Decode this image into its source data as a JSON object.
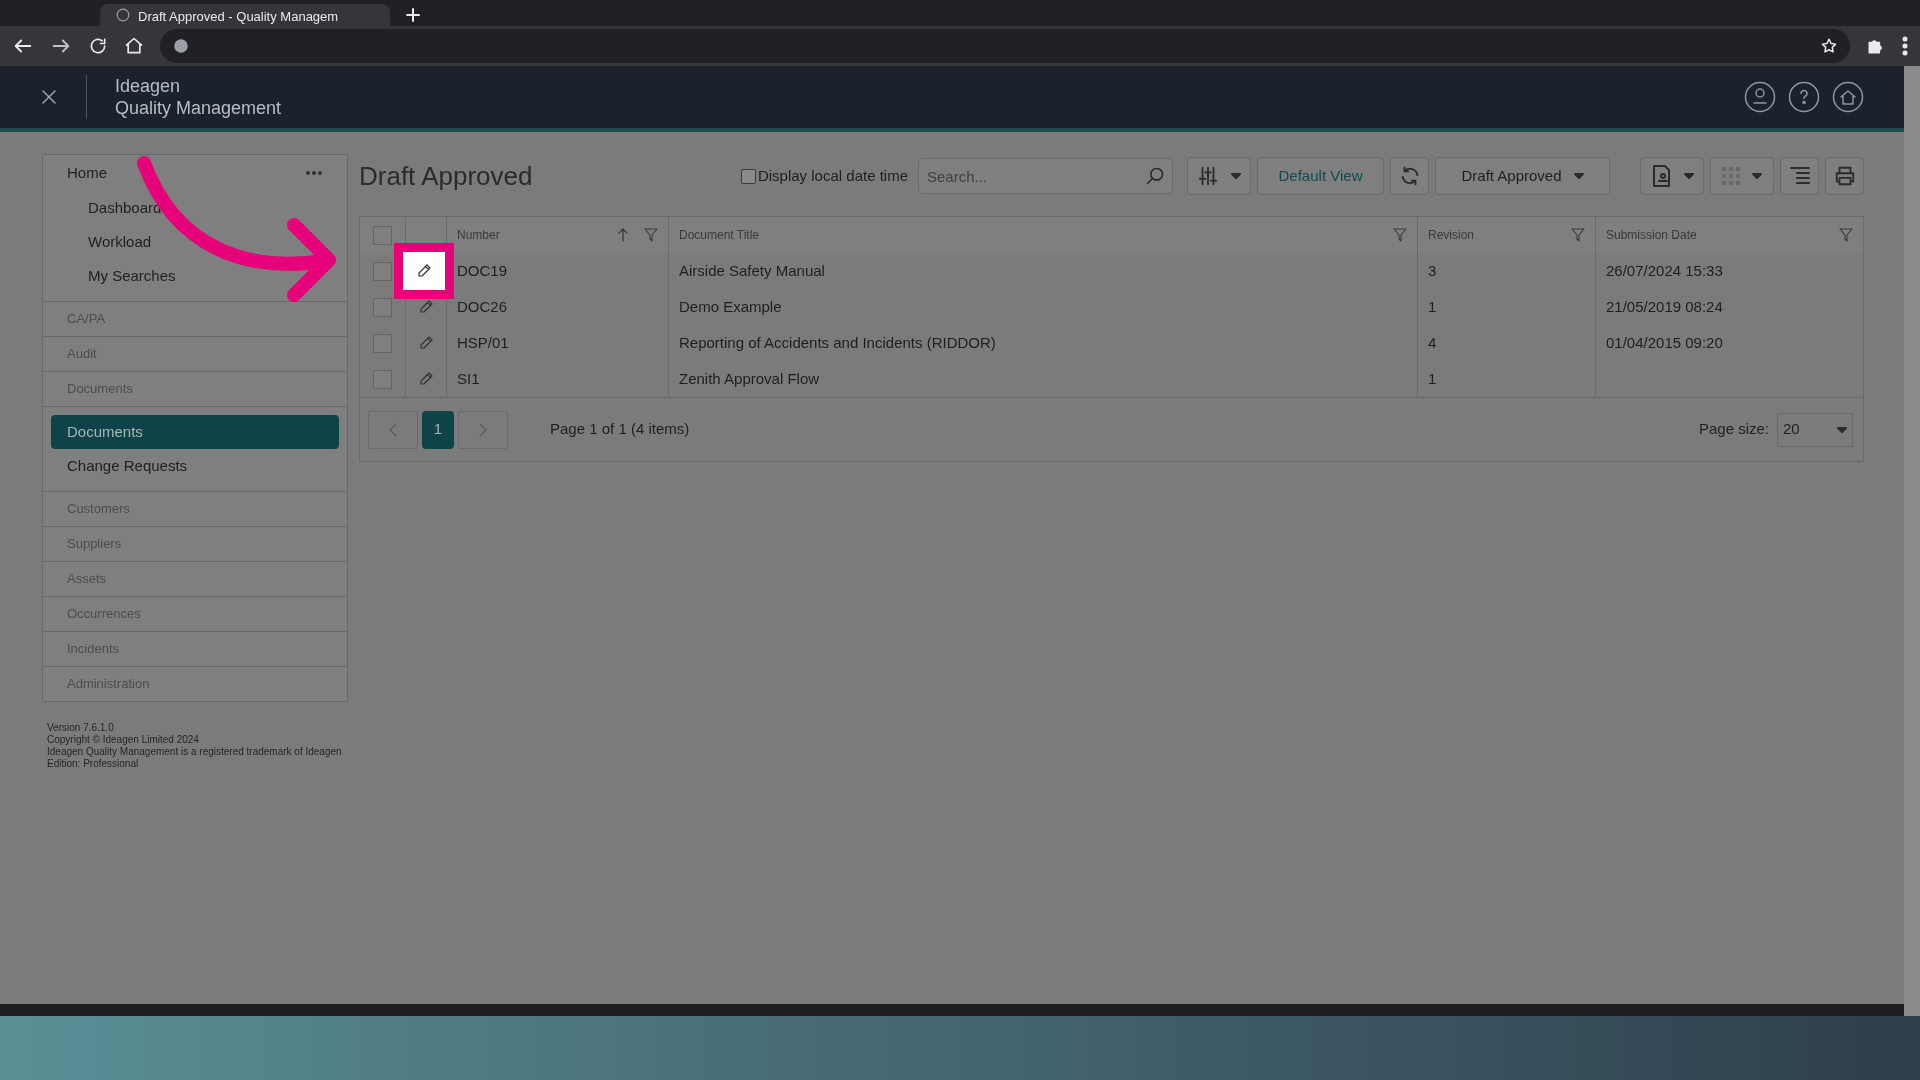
{
  "browser": {
    "tab_title": "Draft Approved - Quality Managem"
  },
  "app_header": {
    "brand": "Ideagen",
    "product": "Quality Management"
  },
  "sidebar": {
    "home": {
      "label": "Home",
      "children": [
        {
          "label": "Dashboard",
          "selected": false
        },
        {
          "label": "Workload",
          "selected": false
        },
        {
          "label": "My Searches",
          "selected": false
        }
      ]
    },
    "sections": [
      {
        "label": "CA/PA"
      },
      {
        "label": "Audit"
      },
      {
        "label": "Documents",
        "children": [
          {
            "label": "Documents",
            "selected": true
          },
          {
            "label": "Change Requests",
            "selected": false
          }
        ]
      },
      {
        "label": "Customers"
      },
      {
        "label": "Suppliers"
      },
      {
        "label": "Assets"
      },
      {
        "label": "Occurrences"
      },
      {
        "label": "Incidents"
      },
      {
        "label": "Administration"
      }
    ],
    "footer": [
      "Version 7.6.1.0",
      "Copyright © Ideagen Limited 2024",
      "Ideagen Quality Management is a registered trademark of Ideagen",
      "Edition: Professional"
    ]
  },
  "page_title": "Draft Approved",
  "toolbar": {
    "local_date_time": {
      "label": "Display local date time",
      "checked": false
    },
    "search": {
      "placeholder": "Search..."
    },
    "default_view": "Default View",
    "view_select": "Draft Approved"
  },
  "table": {
    "all_selected": false,
    "columns": [
      {
        "label": "Number",
        "sort_ascending": true,
        "filter": true
      },
      {
        "label": "Document Title",
        "sort_ascending": false,
        "filter": true
      },
      {
        "label": "Revision",
        "sort_ascending": false,
        "filter": true
      },
      {
        "label": "Submission Date",
        "sort_ascending": false,
        "filter": true
      }
    ],
    "rows": [
      {
        "selected": false,
        "highlighted": true,
        "cells": [
          "DOC19",
          "Airside Safety Manual",
          "3",
          "26/07/2024 15:33"
        ]
      },
      {
        "selected": false,
        "highlighted": false,
        "cells": [
          "DOC26",
          "Demo Example",
          "1",
          "21/05/2019 08:24"
        ]
      },
      {
        "selected": false,
        "highlighted": false,
        "cells": [
          "HSP/01",
          "Reporting of Accidents and Incidents (RIDDOR)",
          "4",
          "01/04/2015 09:20"
        ]
      },
      {
        "selected": false,
        "highlighted": false,
        "cells": [
          "SI1",
          "Zenith Approval Flow",
          "1",
          ""
        ]
      }
    ]
  },
  "pagination": {
    "pages": [
      {
        "label": "1",
        "selected": true
      }
    ],
    "summary": "Page 1 of 1 (4 items)",
    "page_size_label": "Page size:",
    "page_size": "20"
  }
}
